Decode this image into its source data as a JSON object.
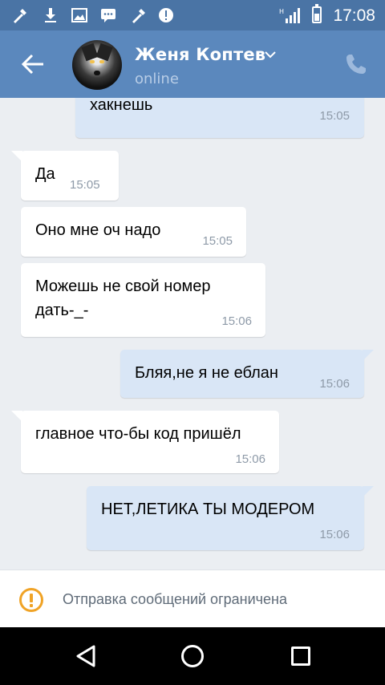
{
  "status_bar": {
    "time": "17:08",
    "network": "H"
  },
  "header": {
    "contact_name": "Женя Коптев",
    "contact_status": "online"
  },
  "messages": [
    {
      "direction": "out",
      "text": "хакнешь",
      "time": "15:05"
    },
    {
      "direction": "in",
      "text": "Да",
      "time": "15:05"
    },
    {
      "direction": "in",
      "text": "Оно мне оч надо",
      "time": "15:05"
    },
    {
      "direction": "in",
      "text": "Можешь не свой номер\nдать-_-",
      "time": "15:06"
    },
    {
      "direction": "out",
      "text": "Бляя,не я не еблан",
      "time": "15:06"
    },
    {
      "direction": "in",
      "text": "главное что-бы код пришёл",
      "time": "15:06"
    },
    {
      "direction": "out",
      "text": "НЕТ,ЛЕТИКА ТЫ МОДЕРОМ",
      "time": "15:06"
    }
  ],
  "banner": {
    "text": "Отправка сообщений ограничена"
  },
  "colors": {
    "header": "#5b88bd",
    "status_bar": "#4a74a5",
    "outgoing_bubble": "#d9e6f6",
    "incoming_bubble": "#ffffff",
    "warning": "#f0a326"
  }
}
